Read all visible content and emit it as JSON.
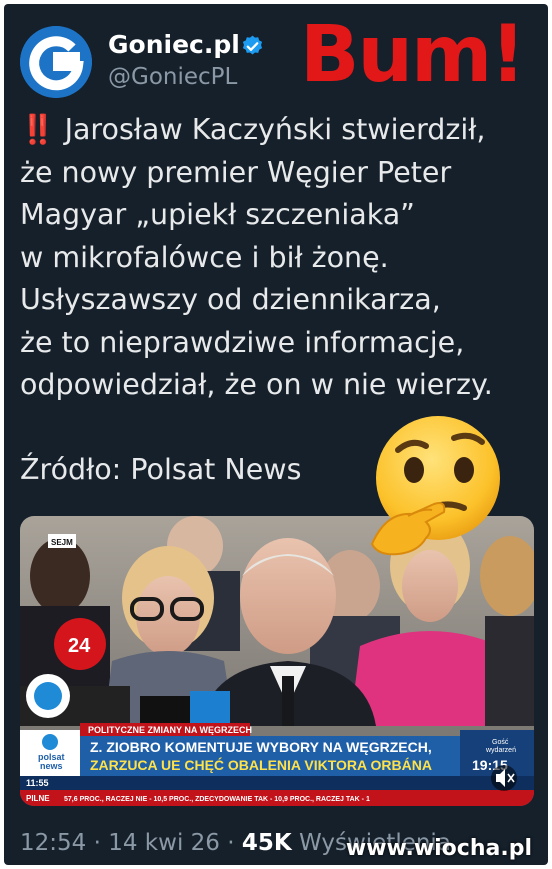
{
  "account": {
    "display_name": "Goniec.pl",
    "handle": "@GoniecPL",
    "avatar_letter": "G",
    "verified_icon": "verified-badge-icon"
  },
  "overlay_caption": "Bum!",
  "tweet": {
    "alert_icon": "‼️",
    "lines": [
      "Jarosław Kaczyński stwierdził,",
      "że nowy premier Węgier Peter",
      "Magyar „upiekł szczeniaka”",
      "w mikrofalówce i bił żonę.",
      "Usłyszawszy od dziennikarza,",
      "że to nieprawdziwe informacje,",
      "odpowiedział, że on w nie wierzy."
    ],
    "source": "Źródło: Polsat News"
  },
  "media": {
    "ticker_tag": "POLITYCZNE ZMIANY NA WĘGRZECH",
    "headline_1": "Z. ZIOBRO KOMENTUJE WYBORY NA WĘGRZECH,",
    "headline_2": "ZARZUCA UE CHĘĆ OBALENIA VIKTORA ORBÁNA",
    "crawl_label": "PILNE",
    "crawl_text": "57,6 PROC., RACZEJ NIE - 10,5 PROC., ZDECYDOWANIE TAK - 10,9 PROC., RACZEJ TAK - 1",
    "channel_line1": "polsat",
    "channel_line2": "news",
    "clock": "11:55",
    "next_label_1": "Gość",
    "next_label_2": "wydarzeń",
    "next_time": "19:15",
    "corner_tag": "SEJM",
    "mic_logo": "24"
  },
  "footer": {
    "time": "12:54",
    "sep1": "·",
    "date": "14 kwi 26",
    "sep2": "·",
    "views": "45K",
    "views_label": "Wyświetlenia"
  },
  "watermark": "www.wiocha.pl",
  "colors": {
    "background": "#15202b",
    "text": "#e7e9ea",
    "muted": "#8b98a5",
    "bum": "#e21818",
    "verified": "#1d9bf0",
    "tv_red": "#d4151c",
    "tv_blue": "#1f5fa8"
  },
  "emoji_icon": "thinking-face-icon"
}
